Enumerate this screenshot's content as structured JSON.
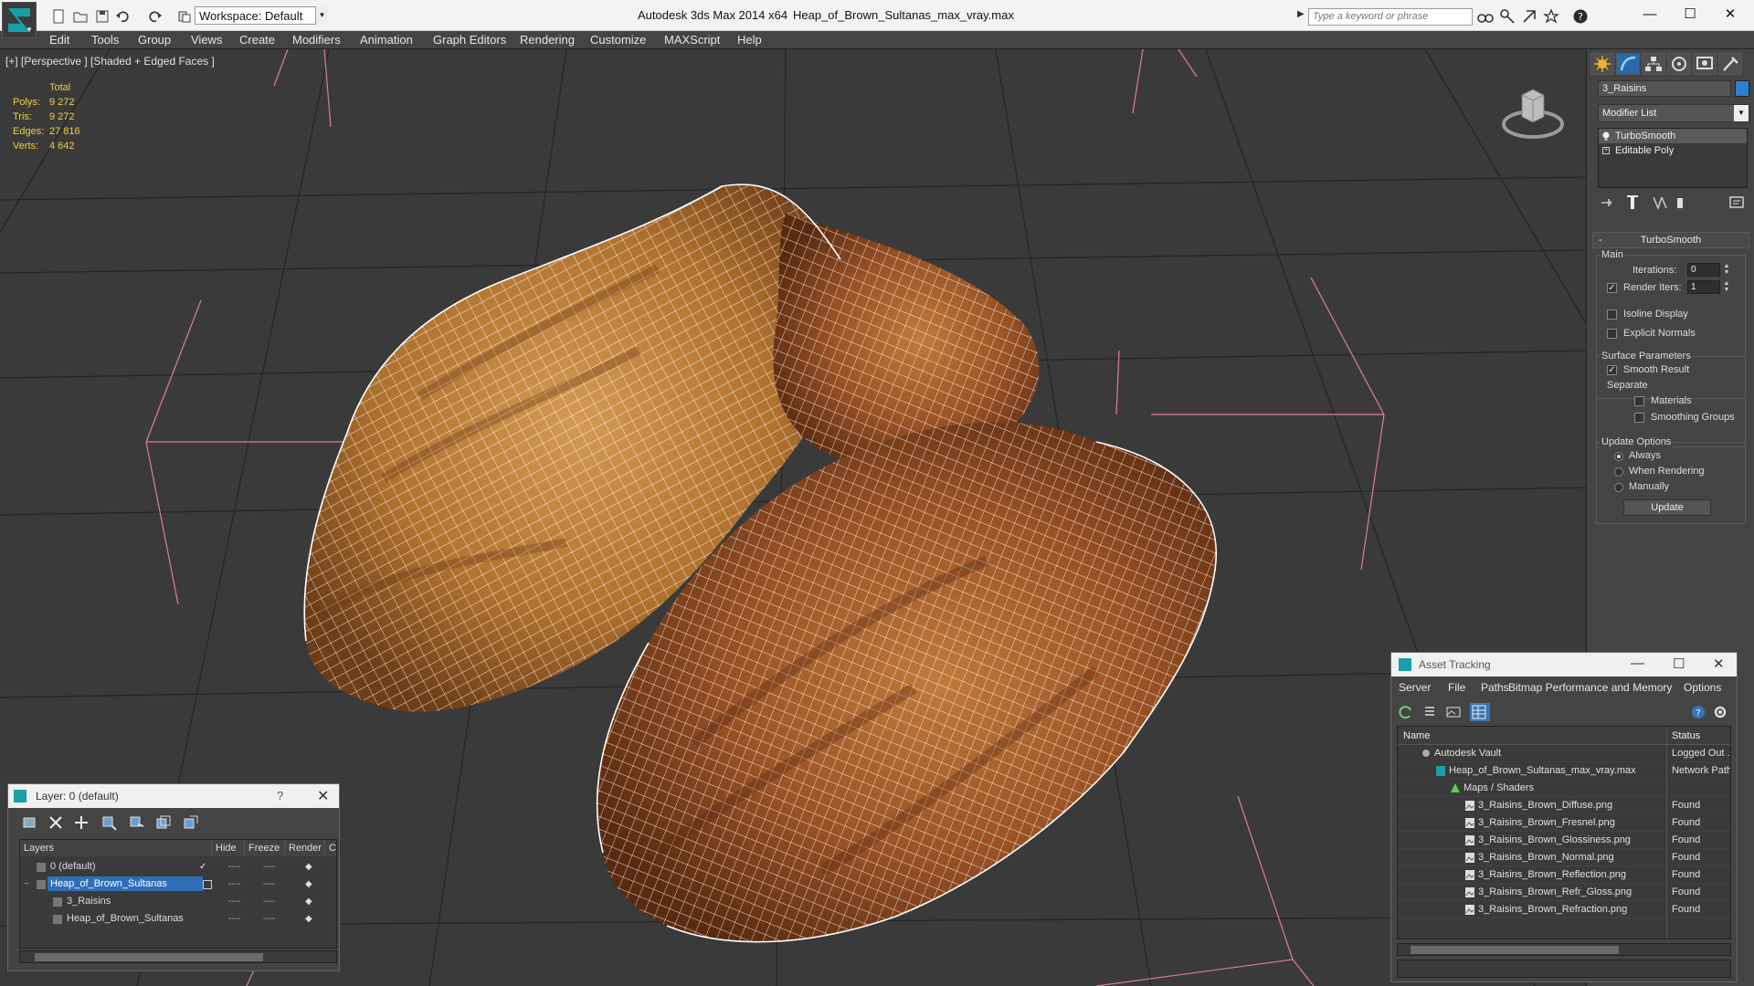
{
  "titlebar": {
    "workspace": "Workspace: Default",
    "app_title": "Autodesk 3ds Max  2014 x64",
    "file_title": "Heap_of_Brown_Sultanas_max_vray.max",
    "search_placeholder": "Type a keyword or phrase",
    "minimize": "—",
    "maximize": "☐",
    "close": "✕"
  },
  "menu": [
    "Edit",
    "Tools",
    "Group",
    "Views",
    "Create",
    "Modifiers",
    "Animation",
    "Graph Editors",
    "Rendering",
    "Customize",
    "MAXScript",
    "Help"
  ],
  "viewport": {
    "label": "[+] [Perspective ] [Shaded + Edged Faces ]",
    "stats_header": "Total",
    "stats": [
      {
        "label": "Polys:",
        "value": "9 272"
      },
      {
        "label": "Tris:",
        "value": "9 272"
      },
      {
        "label": "Edges:",
        "value": "27 816"
      },
      {
        "label": "Verts:",
        "value": "4 642"
      }
    ]
  },
  "command_panel": {
    "object_name": "3_Raisins",
    "object_color": "#2f7fd0",
    "modifier_list": "Modifier List",
    "stack": [
      "TurboSmooth",
      "Editable Poly"
    ],
    "rollout_title": "TurboSmooth",
    "main_group": "Main",
    "iterations_label": "Iterations:",
    "iterations_value": "0",
    "render_iters_label": "Render Iters:",
    "render_iters_value": "1",
    "render_iters_checked": true,
    "isoline_label": "Isoline Display",
    "explicit_normals_label": "Explicit Normals",
    "surface_group": "Surface Parameters",
    "smooth_result_label": "Smooth Result",
    "separate_label": "Separate",
    "materials_label": "Materials",
    "smoothing_groups_label": "Smoothing Groups",
    "update_group": "Update Options",
    "update_always": "Always",
    "update_when_rendering": "When Rendering",
    "update_manually": "Manually",
    "update_button": "Update"
  },
  "layer_dialog": {
    "title": "Layer: 0 (default)",
    "help": "?",
    "close": "✕",
    "columns": [
      "Layers",
      "Hide",
      "Freeze",
      "Render",
      "C"
    ],
    "rows": [
      {
        "name": "0 (default)",
        "indent": 0
      },
      {
        "name": "Heap_of_Brown_Sultanas",
        "indent": 0
      },
      {
        "name": "3_Raisins",
        "indent": 1
      },
      {
        "name": "Heap_of_Brown_Sultanas",
        "indent": 1
      }
    ],
    "check_mark": "✓"
  },
  "asset_dialog": {
    "title": "Asset Tracking",
    "menu": [
      "Server",
      "File",
      "Paths",
      "Bitmap Performance and Memory",
      "Options"
    ],
    "columns": [
      "Name",
      "Status"
    ],
    "rows": [
      {
        "name": "Autodesk Vault",
        "status": "Logged Out ...",
        "indent": 0
      },
      {
        "name": "Heap_of_Brown_Sultanas_max_vray.max",
        "status": "Network Path",
        "indent": 1
      },
      {
        "name": "Maps / Shaders",
        "status": "",
        "indent": 2
      },
      {
        "name": "3_Raisins_Brown_Diffuse.png",
        "status": "Found",
        "indent": 3
      },
      {
        "name": "3_Raisins_Brown_Fresnel.png",
        "status": "Found",
        "indent": 3
      },
      {
        "name": "3_Raisins_Brown_Glossiness.png",
        "status": "Found",
        "indent": 3
      },
      {
        "name": "3_Raisins_Brown_Normal.png",
        "status": "Found",
        "indent": 3
      },
      {
        "name": "3_Raisins_Brown_Reflection.png",
        "status": "Found",
        "indent": 3
      },
      {
        "name": "3_Raisins_Brown_Refr_Gloss.png",
        "status": "Found",
        "indent": 3
      },
      {
        "name": "3_Raisins_Brown_Refraction.png",
        "status": "Found",
        "indent": 3
      }
    ]
  },
  "colors": {
    "accent": "#18a0a8",
    "stats_text": "#f0d040",
    "selection": "#2f6fb8",
    "raisin": "#a8652a",
    "wire": "#ffffff",
    "bbox": "#e07aa0"
  }
}
